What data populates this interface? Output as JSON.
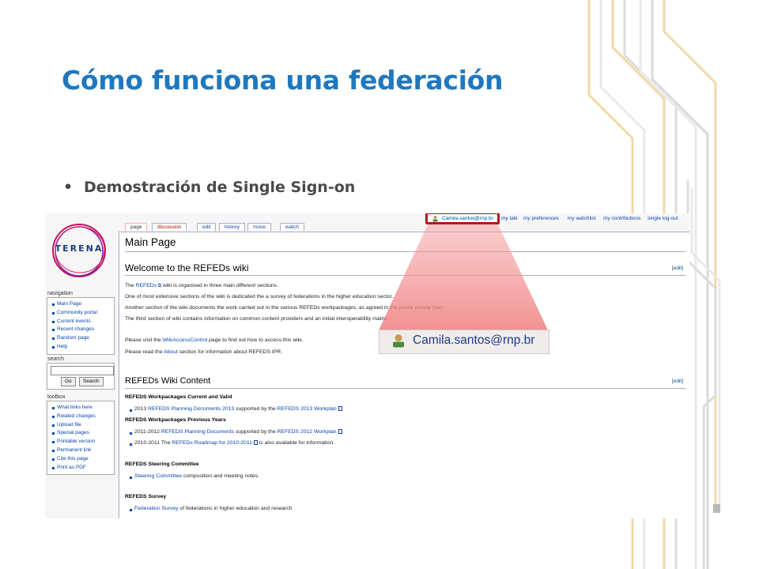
{
  "slide": {
    "title": "Cómo funciona una federación",
    "bullet": "Demostración de Single Sign-on"
  },
  "logo": {
    "text": "TERENA"
  },
  "tabs": [
    {
      "label": "page"
    },
    {
      "label": "discussion"
    },
    {
      "label": "edit"
    },
    {
      "label": "history"
    },
    {
      "label": "move"
    },
    {
      "label": "watch"
    }
  ],
  "personal_tools": {
    "user": "Camila.santos@rnp.br",
    "items": [
      "my talk",
      "my preferences",
      "my watchlist",
      "my contributions",
      "single log-out"
    ]
  },
  "sidebar": {
    "navigation_title": "navigation",
    "navigation": [
      "Main Page",
      "Community portal",
      "Current events",
      "Recent changes",
      "Random page",
      "Help"
    ],
    "search_title": "search",
    "search_buttons": {
      "go": "Go",
      "search": "Search"
    },
    "toolbox_title": "toolbox",
    "toolbox": [
      "What links here",
      "Related changes",
      "Upload file",
      "Special pages",
      "Printable version",
      "Permanent link",
      "Cite this page",
      "Print as PDF"
    ]
  },
  "content": {
    "page_title": "Main Page",
    "welcome_heading": "Welcome to the REFEDs wiki",
    "edit_label": "edit",
    "intro": {
      "p1_link": "REFEDs",
      "p1_text": " wiki is organised in three main different sections.",
      "p1_prefix": "The ",
      "p2": "One of most extensive sections of the wiki is dedicated the a survey of federations in the higher education sector.",
      "p3": "Another section of the wiki documents the work carried out in the various REFEDs workpackages, as agreed in the yearly activity plan.",
      "p4": "The third section of wiki contains information on common content providers and an initial interoperability matrix.",
      "p5_prefix": "Please visit the ",
      "p5_link": "WikiAccessControl",
      "p5_suffix": " page to find out how to access this wiki.",
      "p6_prefix": "Please read the ",
      "p6_link": "About",
      "p6_suffix": " section for information about REFEDS IPR."
    },
    "wiki_content_heading": "REFEDs Wiki Content",
    "sections": {
      "wp_current": "REFEDS Workpackages Current and Valid",
      "wp_current_item": {
        "prefix": "2013 ",
        "link1": "REFEDS Planning Documents 2013",
        "mid": " supported by the ",
        "link2": "REFEDS 2013 Workplan"
      },
      "wp_previous": "REFEDS Workpackages Previous Years",
      "wp_prev_item1": {
        "prefix": "2011-2012 ",
        "link1": "REFEDS Planning Documents",
        "mid": " supported by the ",
        "link2": "REFEDS 2012 Workplan"
      },
      "wp_prev_item2": {
        "prefix": "2010-2011 The ",
        "link1": "REFEDs Roadmap for 2010-2011",
        "suffix": " is also available for information."
      },
      "steering": "REFEDS Steering Committee",
      "steering_item": {
        "link": "Steering Committee",
        "suffix": " composition and meeting notes."
      },
      "survey": "REFEDS Survey",
      "survey_item": {
        "link": "Federation Survey",
        "suffix": " of federations in higher education and research"
      }
    }
  },
  "zoom": {
    "label": "Camila.santos@rnp.br"
  },
  "colors": {
    "title": "#1f78bf",
    "highlight": "#b5161f",
    "link": "#0645ad"
  }
}
